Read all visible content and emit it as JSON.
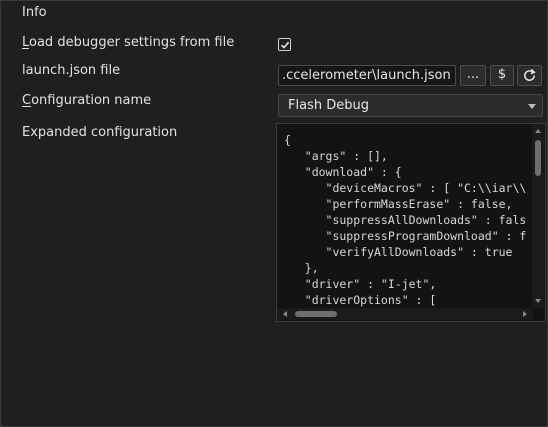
{
  "section": {
    "title": "Info"
  },
  "fields": {
    "load_settings": {
      "label_prefix": "",
      "label_accel": "L",
      "label_rest": "oad debugger settings from file",
      "checked": true
    },
    "launch_json": {
      "label": "launch.json file",
      "value": ".ccelerometer\\launch.json",
      "browse_label": "...",
      "macro_label": "$"
    },
    "config_name": {
      "label_accel": "C",
      "label_rest": "onfiguration name",
      "value": "Flash Debug"
    },
    "expanded": {
      "label": "Expanded configuration"
    }
  },
  "json_lines": [
    "{",
    "   \"args\" : [],",
    "   \"download\" : {",
    "      \"deviceMacros\" : [ \"C:\\\\iar\\\\",
    "      \"performMassErase\" : false,",
    "      \"suppressAllDownloads\" : fals",
    "      \"suppressProgramDownload\" : f",
    "      \"verifyAllDownloads\" : true",
    "   },",
    "   \"driver\" : \"I-jet\",",
    "   \"driverOptions\" : ["
  ],
  "icons": {
    "checkbox": "checkmark-icon",
    "refresh": "refresh-icon",
    "dropdown": "chevron-down-icon"
  },
  "colors": {
    "background": "#1f1f1f",
    "input_background": "#161616",
    "text": "#e6e6e6"
  }
}
